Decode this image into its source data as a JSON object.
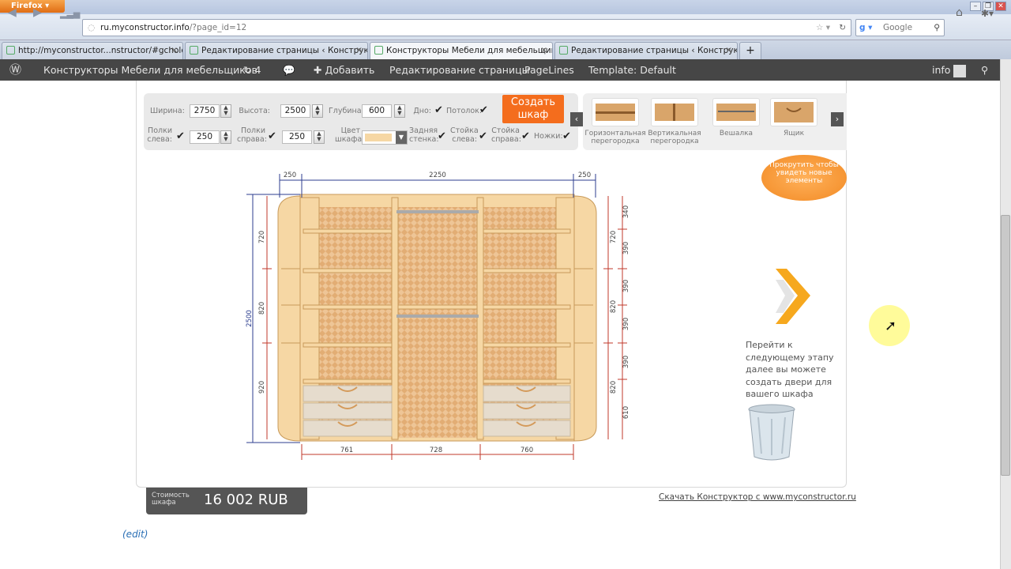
{
  "browser": {
    "menu_button": "Firefox",
    "url_host": "ru.myconstructor.info",
    "url_path": "/?page_id=12",
    "search_placeholder": "Google",
    "tabs": [
      {
        "label": "http://myconstructor...nstructor/#gcholder"
      },
      {
        "label": "Редактирование страницы ‹ Конструк..."
      },
      {
        "label": "Конструкторы Мебели для мебельщик..."
      },
      {
        "label": "Редактирование страницы ‹ Конструк..."
      }
    ]
  },
  "adminbar": {
    "site_name": "Конструкторы Мебели для мебельщиков",
    "updates_count": "4",
    "add_label": "Добавить",
    "edit_page": "Редактирование страницы",
    "pagelines": "PageLines",
    "template": "Template: Default",
    "user": "info"
  },
  "controls": {
    "width_label": "Ширина:",
    "width_value": "2750",
    "height_label": "Высота:",
    "height_value": "2500",
    "depth_label": "Глубина:",
    "depth_value": "600",
    "bottom_label": "Дно:",
    "ceiling_label": "Потолок:",
    "create_button": "Создать шкаф",
    "left_shelves_label": "Полки слева:",
    "left_shelves_value": "250",
    "right_shelves_label": "Полки справа:",
    "right_shelves_value": "250",
    "color_label": "Цвет шкафа:",
    "color_value": "#f6d7a4",
    "back_wall_label": "Задняя стенка:",
    "left_post_label": "Стойка слева:",
    "right_post_label": "Стойка справа:",
    "legs_label": "Ножки:"
  },
  "items": [
    {
      "label": "Горизонтальная перегородка",
      "icon": "horizontal-partition-icon"
    },
    {
      "label": "Вертикальная перегородка",
      "icon": "vertical-partition-icon"
    },
    {
      "label": "Вешалка",
      "icon": "hanger-rod-icon"
    },
    {
      "label": "Ящик",
      "icon": "drawer-icon"
    }
  ],
  "bubble_text": "Прокрутить чтобы увидеть новые элементы",
  "drawing": {
    "top_dims": [
      "250",
      "2250",
      "250"
    ],
    "bottom_dims": [
      "761",
      "728",
      "760"
    ],
    "total_height": "2500",
    "left_dims": [
      "720",
      "820",
      "920"
    ],
    "right_dims_outer": [
      "720",
      "820",
      "820"
    ],
    "right_dims_inner": [
      "340",
      "390",
      "390",
      "390",
      "390",
      "610"
    ]
  },
  "next_step_text": "Перейти к следующему этапу далее вы можете создать двери для вашего шкафа",
  "price": {
    "label": "Стоимость шкафа",
    "value": "16 002 RUB"
  },
  "download_link": "Скачать Конструктор с www.myconstructor.ru",
  "edit_link": "(edit)",
  "colors": {
    "accent": "#f46d1d",
    "wp_bar": "#464646",
    "wood": "#f6d7a4",
    "dimension_lines": "#c0392b",
    "dimension_blue": "#2c3e8f"
  }
}
